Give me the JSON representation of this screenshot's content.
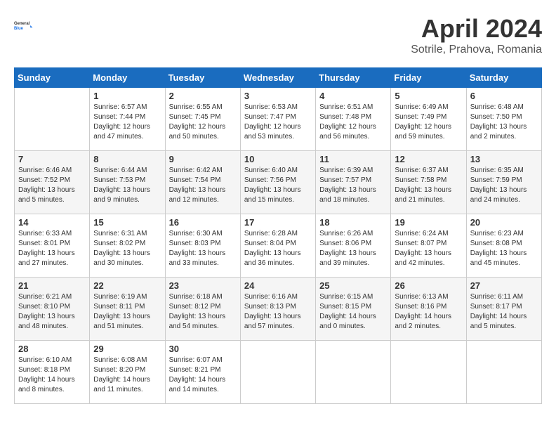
{
  "header": {
    "logo_line1": "General",
    "logo_line2": "Blue",
    "month": "April 2024",
    "location": "Sotrile, Prahova, Romania"
  },
  "weekdays": [
    "Sunday",
    "Monday",
    "Tuesday",
    "Wednesday",
    "Thursday",
    "Friday",
    "Saturday"
  ],
  "weeks": [
    [
      {
        "num": "",
        "info": ""
      },
      {
        "num": "1",
        "info": "Sunrise: 6:57 AM\nSunset: 7:44 PM\nDaylight: 12 hours\nand 47 minutes."
      },
      {
        "num": "2",
        "info": "Sunrise: 6:55 AM\nSunset: 7:45 PM\nDaylight: 12 hours\nand 50 minutes."
      },
      {
        "num": "3",
        "info": "Sunrise: 6:53 AM\nSunset: 7:47 PM\nDaylight: 12 hours\nand 53 minutes."
      },
      {
        "num": "4",
        "info": "Sunrise: 6:51 AM\nSunset: 7:48 PM\nDaylight: 12 hours\nand 56 minutes."
      },
      {
        "num": "5",
        "info": "Sunrise: 6:49 AM\nSunset: 7:49 PM\nDaylight: 12 hours\nand 59 minutes."
      },
      {
        "num": "6",
        "info": "Sunrise: 6:48 AM\nSunset: 7:50 PM\nDaylight: 13 hours\nand 2 minutes."
      }
    ],
    [
      {
        "num": "7",
        "info": "Sunrise: 6:46 AM\nSunset: 7:52 PM\nDaylight: 13 hours\nand 5 minutes."
      },
      {
        "num": "8",
        "info": "Sunrise: 6:44 AM\nSunset: 7:53 PM\nDaylight: 13 hours\nand 9 minutes."
      },
      {
        "num": "9",
        "info": "Sunrise: 6:42 AM\nSunset: 7:54 PM\nDaylight: 13 hours\nand 12 minutes."
      },
      {
        "num": "10",
        "info": "Sunrise: 6:40 AM\nSunset: 7:56 PM\nDaylight: 13 hours\nand 15 minutes."
      },
      {
        "num": "11",
        "info": "Sunrise: 6:39 AM\nSunset: 7:57 PM\nDaylight: 13 hours\nand 18 minutes."
      },
      {
        "num": "12",
        "info": "Sunrise: 6:37 AM\nSunset: 7:58 PM\nDaylight: 13 hours\nand 21 minutes."
      },
      {
        "num": "13",
        "info": "Sunrise: 6:35 AM\nSunset: 7:59 PM\nDaylight: 13 hours\nand 24 minutes."
      }
    ],
    [
      {
        "num": "14",
        "info": "Sunrise: 6:33 AM\nSunset: 8:01 PM\nDaylight: 13 hours\nand 27 minutes."
      },
      {
        "num": "15",
        "info": "Sunrise: 6:31 AM\nSunset: 8:02 PM\nDaylight: 13 hours\nand 30 minutes."
      },
      {
        "num": "16",
        "info": "Sunrise: 6:30 AM\nSunset: 8:03 PM\nDaylight: 13 hours\nand 33 minutes."
      },
      {
        "num": "17",
        "info": "Sunrise: 6:28 AM\nSunset: 8:04 PM\nDaylight: 13 hours\nand 36 minutes."
      },
      {
        "num": "18",
        "info": "Sunrise: 6:26 AM\nSunset: 8:06 PM\nDaylight: 13 hours\nand 39 minutes."
      },
      {
        "num": "19",
        "info": "Sunrise: 6:24 AM\nSunset: 8:07 PM\nDaylight: 13 hours\nand 42 minutes."
      },
      {
        "num": "20",
        "info": "Sunrise: 6:23 AM\nSunset: 8:08 PM\nDaylight: 13 hours\nand 45 minutes."
      }
    ],
    [
      {
        "num": "21",
        "info": "Sunrise: 6:21 AM\nSunset: 8:10 PM\nDaylight: 13 hours\nand 48 minutes."
      },
      {
        "num": "22",
        "info": "Sunrise: 6:19 AM\nSunset: 8:11 PM\nDaylight: 13 hours\nand 51 minutes."
      },
      {
        "num": "23",
        "info": "Sunrise: 6:18 AM\nSunset: 8:12 PM\nDaylight: 13 hours\nand 54 minutes."
      },
      {
        "num": "24",
        "info": "Sunrise: 6:16 AM\nSunset: 8:13 PM\nDaylight: 13 hours\nand 57 minutes."
      },
      {
        "num": "25",
        "info": "Sunrise: 6:15 AM\nSunset: 8:15 PM\nDaylight: 14 hours\nand 0 minutes."
      },
      {
        "num": "26",
        "info": "Sunrise: 6:13 AM\nSunset: 8:16 PM\nDaylight: 14 hours\nand 2 minutes."
      },
      {
        "num": "27",
        "info": "Sunrise: 6:11 AM\nSunset: 8:17 PM\nDaylight: 14 hours\nand 5 minutes."
      }
    ],
    [
      {
        "num": "28",
        "info": "Sunrise: 6:10 AM\nSunset: 8:18 PM\nDaylight: 14 hours\nand 8 minutes."
      },
      {
        "num": "29",
        "info": "Sunrise: 6:08 AM\nSunset: 8:20 PM\nDaylight: 14 hours\nand 11 minutes."
      },
      {
        "num": "30",
        "info": "Sunrise: 6:07 AM\nSunset: 8:21 PM\nDaylight: 14 hours\nand 14 minutes."
      },
      {
        "num": "",
        "info": ""
      },
      {
        "num": "",
        "info": ""
      },
      {
        "num": "",
        "info": ""
      },
      {
        "num": "",
        "info": ""
      }
    ]
  ]
}
